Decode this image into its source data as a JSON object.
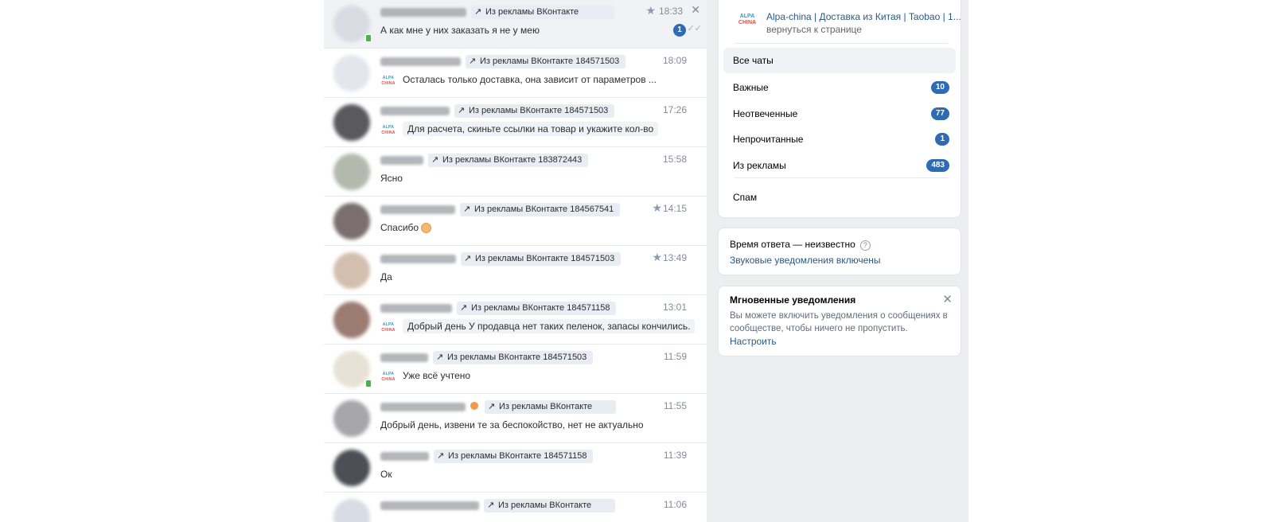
{
  "chats": [
    {
      "badge": "Из рекламы ВКонтакте",
      "time": "18:33",
      "message": "А как мне у них заказать я не у мею",
      "starred": true,
      "closable": true,
      "unread": "1",
      "read_check": true,
      "logo": false,
      "boxed": false,
      "online": true,
      "active": true,
      "avatar": "#d9dbe2",
      "name_w": 108,
      "badge_w": 180
    },
    {
      "badge": "Из рекламы ВКонтакте 184571503",
      "time": "18:09",
      "message": "Осталась только доставка, она зависит от параметров ...",
      "logo": true,
      "boxed": false,
      "avatar": "#e3e6ec",
      "name_w": 101,
      "badge_w": 190
    },
    {
      "badge": "Из рекламы ВКонтакте 184571503",
      "time": "17:26",
      "message": "Для расчета, скиньте ссылки на товар и укажите кол-во",
      "logo": true,
      "boxed": true,
      "avatar": "#5a5a5d",
      "name_w": 87,
      "badge_w": 190
    },
    {
      "badge": "Из рекламы ВКонтакте 183872443",
      "time": "15:58",
      "message": "Ясно",
      "logo": false,
      "boxed": false,
      "avatar": "#b4b9ad",
      "name_w": 54,
      "badge_w": 190
    },
    {
      "badge": "Из рекламы ВКонтакте 184567541",
      "time": "14:15",
      "message": "Спасибо",
      "emoji": true,
      "starred": true,
      "logo": false,
      "boxed": false,
      "avatar": "#7a6e70",
      "name_w": 94,
      "badge_w": 190
    },
    {
      "badge": "Из рекламы ВКонтакте 184571503",
      "time": "13:49",
      "message": "Да",
      "starred": true,
      "logo": false,
      "boxed": false,
      "avatar": "#d4bfae",
      "name_w": 95,
      "badge_w": 190
    },
    {
      "badge": "Из рекламы ВКонтакте 184571158",
      "time": "13:01",
      "message": "Добрый день У продавца нет таких пеленок, запасы кончились.",
      "logo": true,
      "boxed": true,
      "avatar": "#9b7b72",
      "name_w": 90,
      "badge_w": 190
    },
    {
      "badge": "Из рекламы ВКонтакте 184571503",
      "time": "11:59",
      "message": "Уже всё учтено",
      "logo": true,
      "boxed": false,
      "online": true,
      "avatar": "#e8e2d6",
      "name_w": 60,
      "badge_w": 190
    },
    {
      "badge": "Из рекламы ВКонтакте",
      "time": "11:55",
      "message": "Добрый день, извени те за беспокойство, нет не актуально",
      "logo": false,
      "boxed": false,
      "avatar": "#a7a7a9",
      "name_w": 107,
      "badge_w": 165,
      "name_emoji": true
    },
    {
      "badge": "Из рекламы ВКонтакте 184571158",
      "time": "11:39",
      "message": "Ок",
      "logo": false,
      "boxed": false,
      "avatar": "#4c4f55",
      "name_w": 61,
      "badge_w": 190
    },
    {
      "badge": "Из рекламы ВКонтакте",
      "time": "11:06",
      "message": "",
      "logo": false,
      "boxed": false,
      "avatar": "#d8dce4",
      "name_w": 124,
      "badge_w": 165
    }
  ],
  "logo_text": {
    "line1": "ALPA",
    "line2": "CHINA"
  },
  "group": {
    "title": "Alpa-china | Доставка из Китая | Taobao | 1...",
    "back": "вернуться к странице"
  },
  "folders": [
    {
      "label": "Все чаты",
      "count": ""
    },
    {
      "label": "Важные",
      "count": "10"
    },
    {
      "label": "Неотвеченные",
      "count": "77"
    },
    {
      "label": "Непрочитанные",
      "count": "1"
    },
    {
      "label": "Из рекламы",
      "count": "483"
    },
    {
      "label": "Спам",
      "count": ""
    }
  ],
  "response": {
    "time_text": "Время ответа — неизвестно",
    "sound_link": "Звуковые уведомления включены"
  },
  "notify": {
    "title": "Мгновенные уведомления",
    "text": "Вы можете включить уведомления о сообщениях в сообществе, чтобы ничего не пропустить.",
    "link": "Настроить"
  },
  "icons": {
    "arrow": "↗",
    "star": "★",
    "close": "✕",
    "check": "✓✓",
    "help": "?"
  },
  "colors": {
    "accent": "#2d6cb5",
    "link": "#2a5885",
    "badge_bg": "#e8edf3"
  }
}
